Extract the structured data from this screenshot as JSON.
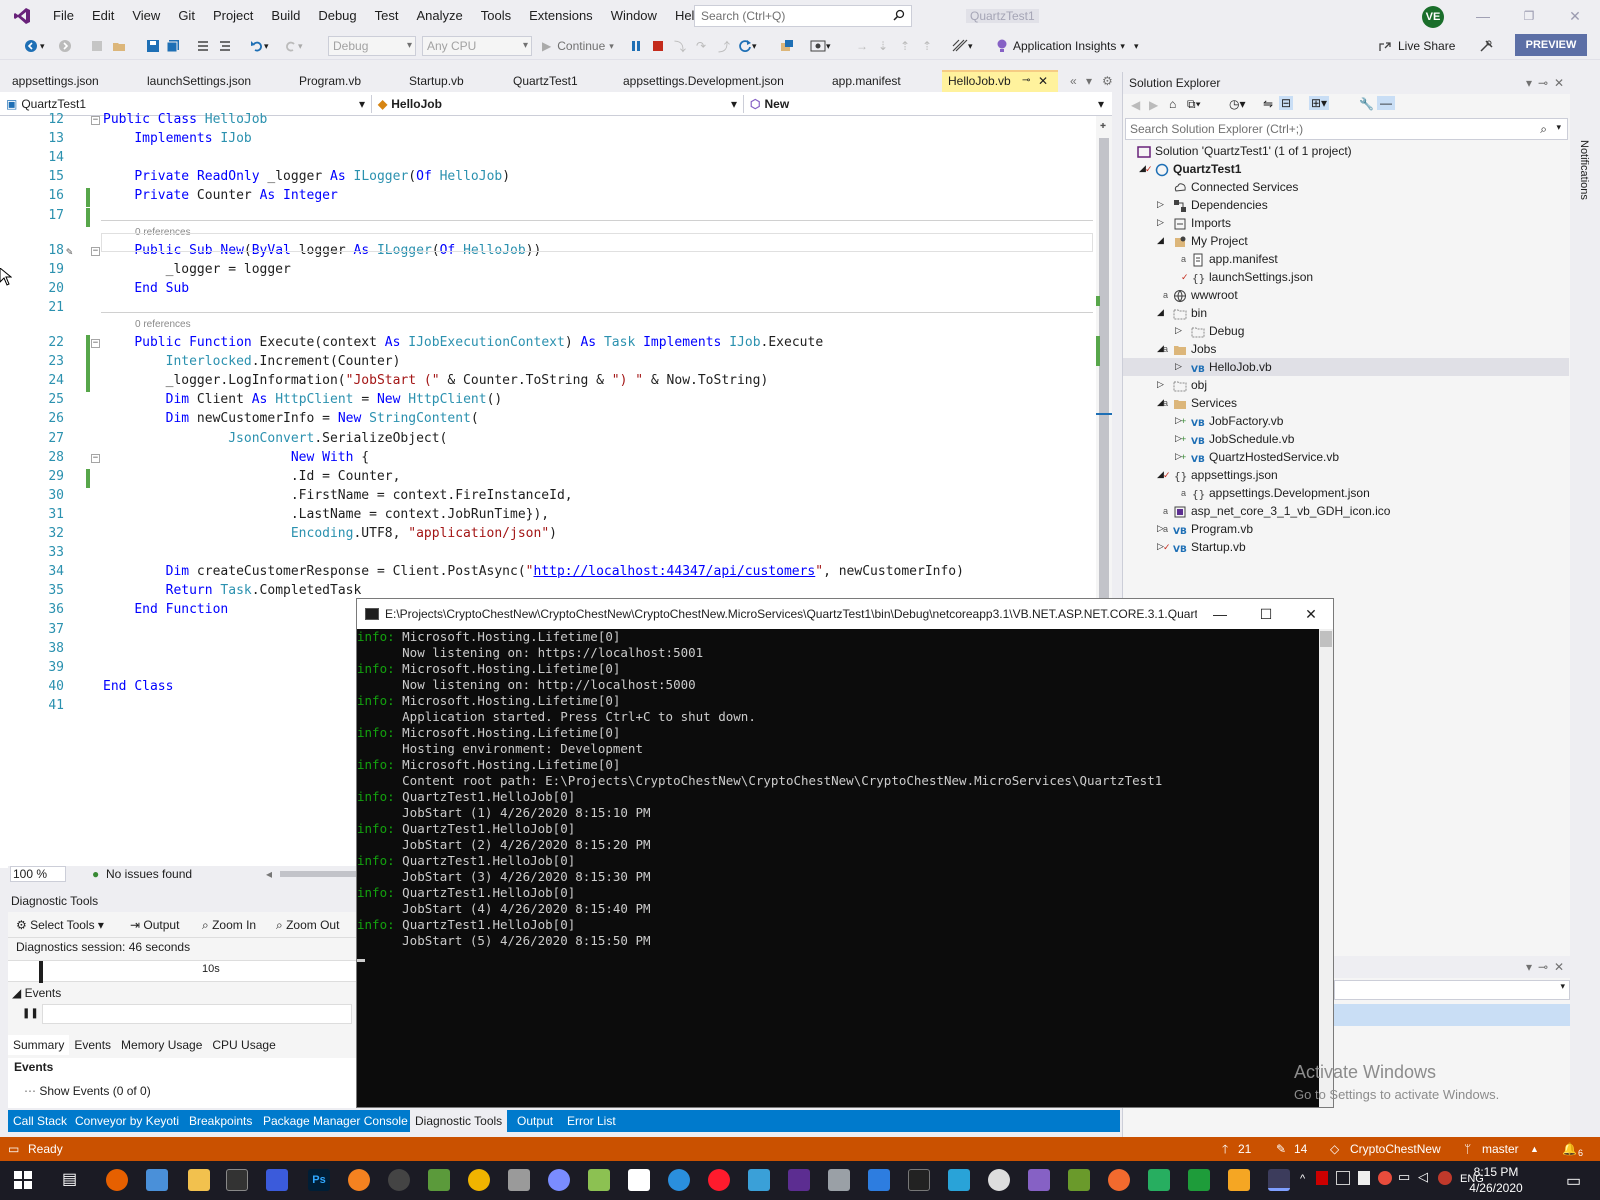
{
  "menu": [
    "File",
    "Edit",
    "View",
    "Git",
    "Project",
    "Build",
    "Debug",
    "Test",
    "Analyze",
    "Tools",
    "Extensions",
    "Window",
    "Help"
  ],
  "search": {
    "placeholder": "Search (Ctrl+Q)"
  },
  "solution_name": "QuartzTest1",
  "user_initials": "VE",
  "toolbar": {
    "config": "Debug",
    "platform": "Any CPU",
    "continue": "Continue",
    "insights": "Application Insights",
    "live_share": "Live Share",
    "preview": "PREVIEW"
  },
  "doc_tabs": [
    "appsettings.json",
    "launchSettings.json",
    "Program.vb",
    "Startup.vb",
    "QuartzTest1",
    "appsettings.Development.json",
    "app.manifest",
    "HelloJob.vb"
  ],
  "navbar": {
    "project": "QuartzTest1",
    "class": "HelloJob",
    "member": "New"
  },
  "code_lines": [
    {
      "n": "12",
      "t": "Public Class HelloJob"
    },
    {
      "n": "13",
      "t": "    Implements IJob"
    },
    {
      "n": "14",
      "t": ""
    },
    {
      "n": "15",
      "t": "    Private ReadOnly _logger As ILogger(Of HelloJob)"
    },
    {
      "n": "16",
      "t": "    Private Counter As Integer"
    },
    {
      "n": "17",
      "t": ""
    },
    {
      "n": "18",
      "t": "    Public Sub New(ByVal logger As ILogger(Of HelloJob))"
    },
    {
      "n": "19",
      "t": "        _logger = logger"
    },
    {
      "n": "20",
      "t": "    End Sub"
    },
    {
      "n": "21",
      "t": ""
    },
    {
      "n": "22",
      "t": "    Public Function Execute(context As IJobExecutionContext) As Task Implements IJob.Execute"
    },
    {
      "n": "23",
      "t": "        Interlocked.Increment(Counter)"
    },
    {
      "n": "24",
      "t": "        _logger.LogInformation(\"JobStart (\" & Counter.ToString & \") \" & Now.ToString)"
    },
    {
      "n": "25",
      "t": "        Dim Client As HttpClient = New HttpClient()"
    },
    {
      "n": "26",
      "t": "        Dim newCustomerInfo = New StringContent("
    },
    {
      "n": "27",
      "t": "                JsonConvert.SerializeObject("
    },
    {
      "n": "28",
      "t": "                        New With {"
    },
    {
      "n": "29",
      "t": "                        .Id = Counter,"
    },
    {
      "n": "30",
      "t": "                        .FirstName = context.FireInstanceId,"
    },
    {
      "n": "31",
      "t": "                        .LastName = context.JobRunTime}),"
    },
    {
      "n": "32",
      "t": "                        Encoding.UTF8, \"application/json\")"
    },
    {
      "n": "33",
      "t": ""
    },
    {
      "n": "34",
      "t": "        Dim createCustomerResponse = Client.PostAsync(\"http://localhost:44347/api/customers\", newCustomerInfo)"
    },
    {
      "n": "35",
      "t": "        Return Task.CompletedTask"
    },
    {
      "n": "36",
      "t": "    End Function"
    },
    {
      "n": "37",
      "t": ""
    },
    {
      "n": "38",
      "t": ""
    },
    {
      "n": "39",
      "t": ""
    },
    {
      "n": "40",
      "t": "End Class"
    },
    {
      "n": "41",
      "t": ""
    }
  ],
  "references_label": "0 references",
  "editor_status": {
    "zoom": "100 %",
    "issues": "No issues found"
  },
  "solution_explorer": {
    "title": "Solution Explorer",
    "search": "Search Solution Explorer (Ctrl+;)",
    "items": [
      {
        "label": "Solution 'QuartzTest1' (1 of 1 project)",
        "bold": false
      },
      {
        "label": "QuartzTest1",
        "bold": true
      },
      {
        "label": "Connected Services"
      },
      {
        "label": "Dependencies"
      },
      {
        "label": "Imports"
      },
      {
        "label": "My Project"
      },
      {
        "label": "app.manifest"
      },
      {
        "label": "launchSettings.json"
      },
      {
        "label": "wwwroot"
      },
      {
        "label": "bin"
      },
      {
        "label": "Debug"
      },
      {
        "label": "Jobs"
      },
      {
        "label": "HelloJob.vb"
      },
      {
        "label": "obj"
      },
      {
        "label": "Services"
      },
      {
        "label": "JobFactory.vb"
      },
      {
        "label": "JobSchedule.vb"
      },
      {
        "label": "QuartzHostedService.vb"
      },
      {
        "label": "appsettings.json"
      },
      {
        "label": "appsettings.Development.json"
      },
      {
        "label": "asp_net_core_3_1_vb_GDH_icon.ico"
      },
      {
        "label": "Program.vb"
      },
      {
        "label": "Startup.vb"
      }
    ]
  },
  "console": {
    "title": "E:\\Projects\\CryptoChestNew\\CryptoChestNew\\CryptoChestNew.MicroServices\\QuartzTest1\\bin\\Debug\\netcoreapp3.1\\VB.NET.ASP.NET.CORE.3.1.Quart...",
    "lines": [
      {
        "p": "info:",
        "t": " Microsoft.Hosting.Lifetime[0]"
      },
      {
        "p": "",
        "t": "      Now listening on: https://localhost:5001"
      },
      {
        "p": "info:",
        "t": " Microsoft.Hosting.Lifetime[0]"
      },
      {
        "p": "",
        "t": "      Now listening on: http://localhost:5000"
      },
      {
        "p": "info:",
        "t": " Microsoft.Hosting.Lifetime[0]"
      },
      {
        "p": "",
        "t": "      Application started. Press Ctrl+C to shut down."
      },
      {
        "p": "info:",
        "t": " Microsoft.Hosting.Lifetime[0]"
      },
      {
        "p": "",
        "t": "      Hosting environment: Development"
      },
      {
        "p": "info:",
        "t": " Microsoft.Hosting.Lifetime[0]"
      },
      {
        "p": "",
        "t": "      Content root path: E:\\Projects\\CryptoChestNew\\CryptoChestNew\\CryptoChestNew.MicroServices\\QuartzTest1"
      },
      {
        "p": "info:",
        "t": " QuartzTest1.HelloJob[0]"
      },
      {
        "p": "",
        "t": "      JobStart (1) 4/26/2020 8:15:10 PM"
      },
      {
        "p": "info:",
        "t": " QuartzTest1.HelloJob[0]"
      },
      {
        "p": "",
        "t": "      JobStart (2) 4/26/2020 8:15:20 PM"
      },
      {
        "p": "info:",
        "t": " QuartzTest1.HelloJob[0]"
      },
      {
        "p": "",
        "t": "      JobStart (3) 4/26/2020 8:15:30 PM"
      },
      {
        "p": "info:",
        "t": " QuartzTest1.HelloJob[0]"
      },
      {
        "p": "",
        "t": "      JobStart (4) 4/26/2020 8:15:40 PM"
      },
      {
        "p": "info:",
        "t": " QuartzTest1.HelloJob[0]"
      },
      {
        "p": "",
        "t": "      JobStart (5) 4/26/2020 8:15:50 PM"
      }
    ]
  },
  "diagnostics": {
    "title": "Diagnostic Tools",
    "select_tools": "Select Tools",
    "output": "Output",
    "zoom_in": "Zoom In",
    "zoom_out": "Zoom Out",
    "session": "Diagnostics session: 46 seconds",
    "tick": "10s",
    "events_header": "Events",
    "tabs": [
      "Summary",
      "Events",
      "Memory Usage",
      "CPU Usage"
    ],
    "events_label": "Events",
    "show_events": "Show Events (0 of 0)"
  },
  "bottom_tabs": [
    "Call Stack",
    "Conveyor by Keyoti",
    "Breakpoints",
    "Package Manager Console",
    "Diagnostic Tools",
    "Output",
    "Error List"
  ],
  "statusbar": {
    "state": "Ready",
    "up": "21",
    "edits": "14",
    "repo": "CryptoChestNew",
    "branch": "master",
    "notif": "6"
  },
  "watermark": {
    "line1": "Activate Windows",
    "line2": "Go to Settings to activate Windows."
  },
  "side_label": "Notifications",
  "clock": {
    "time": "8:15 PM",
    "date": "4/26/2020"
  },
  "tray": {
    "lang": "ENG"
  },
  "colors": {
    "accent": "#007acc",
    "status": "#ca5100",
    "console_bg": "#0c0c0c"
  }
}
